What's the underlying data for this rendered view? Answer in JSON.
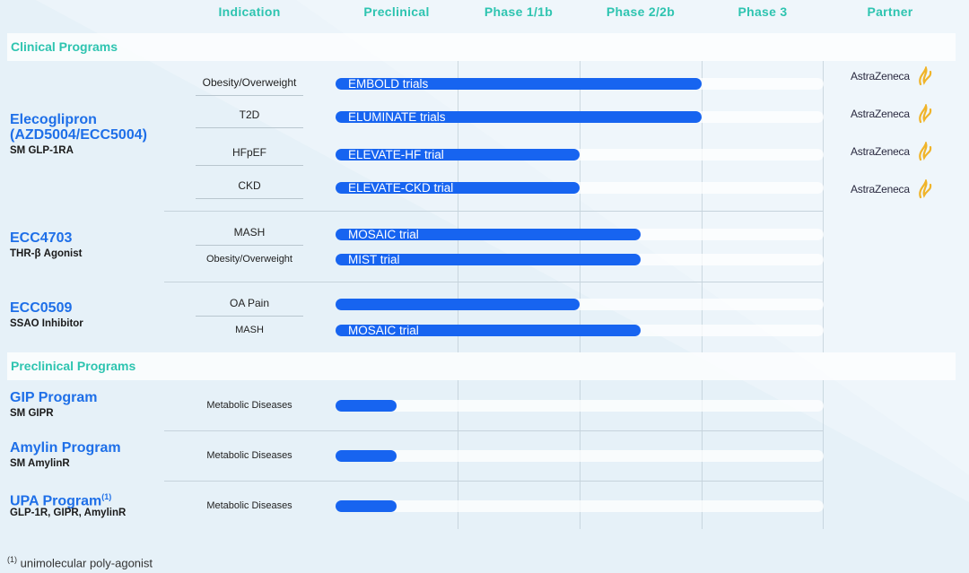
{
  "columns": [
    "Indication",
    "Preclinical",
    "Phase 1/1b",
    "Phase 2/2b",
    "Phase 3",
    "Partner"
  ],
  "sections": {
    "clinical": "Clinical Programs",
    "preclinical": "Preclinical Programs"
  },
  "programs": [
    {
      "name": "Elecoglipron (AZD5004/ECC5004)",
      "name_line1": "Elecoglipron",
      "name_line2": "(AZD5004/ECC5004)",
      "subtitle": "SM GLP-1RA"
    },
    {
      "name": "ECC4703",
      "subtitle": "THR-β Agonist"
    },
    {
      "name": "ECC0509",
      "subtitle": "SSAO Inhibitor"
    },
    {
      "name": "GIP Program",
      "subtitle": "SM GIPR"
    },
    {
      "name": "Amylin Program",
      "subtitle": "SM AmylinR"
    },
    {
      "name": "UPA Program",
      "superscript": "(1)",
      "subtitle": "GLP-1R, GIPR, AmylinR"
    }
  ],
  "rows": [
    {
      "indication": "Obesity/Overweight",
      "trial": "EMBOLD trials",
      "progress_phase": 3.0,
      "partner": "AstraZeneca"
    },
    {
      "indication": "T2D",
      "trial": "ELUMINATE trials",
      "progress_phase": 3.0,
      "partner": "AstraZeneca"
    },
    {
      "indication": "HFpEF",
      "trial": "ELEVATE-HF trial",
      "progress_phase": 2.0,
      "partner": "AstraZeneca"
    },
    {
      "indication": "CKD",
      "trial": "ELEVATE-CKD trial",
      "progress_phase": 2.0,
      "partner": "AstraZeneca"
    },
    {
      "indication": "MASH",
      "trial": "MOSAIC trial",
      "progress_phase": 2.5,
      "partner": ""
    },
    {
      "indication": "Obesity/Overweight",
      "trial": "MIST trial",
      "progress_phase": 2.5,
      "partner": ""
    },
    {
      "indication": "OA Pain",
      "trial": "",
      "progress_phase": 2.0,
      "partner": ""
    },
    {
      "indication": "MASH",
      "trial": "MOSAIC trial",
      "progress_phase": 2.5,
      "partner": ""
    },
    {
      "indication": "Metabolic Diseases",
      "trial": "",
      "progress_phase": 0.5,
      "partner": ""
    },
    {
      "indication": "Metabolic Diseases",
      "trial": "",
      "progress_phase": 0.5,
      "partner": ""
    },
    {
      "indication": "Metabolic Diseases",
      "trial": "",
      "progress_phase": 0.5,
      "partner": ""
    }
  ],
  "footnote": {
    "marker": "(1)",
    "text": "unimolecular poly-agonist"
  },
  "colors": {
    "accent_teal": "#2ec4b0",
    "program_blue": "#1e6fe8",
    "bar_blue": "#1764f0",
    "partner_logo_gold": "#f0b429"
  },
  "icons": {
    "partner_logo": "astrazeneca-logo-icon"
  }
}
